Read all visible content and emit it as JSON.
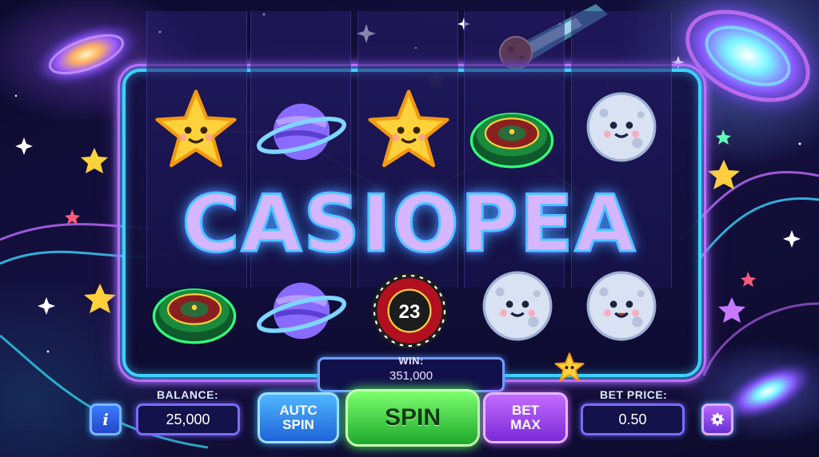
{
  "game": {
    "title": "CASIOPEA"
  },
  "reels": [
    [
      "star",
      "wheel-green"
    ],
    [
      "planet",
      "planet"
    ],
    [
      "star",
      "roulette-wheel"
    ],
    [
      "wheel-green",
      "moon"
    ],
    [
      "moon",
      "moon"
    ]
  ],
  "roulette_number": "23",
  "win": {
    "label": "WIN:",
    "value": "351,000"
  },
  "balance": {
    "label": "BALANCE:",
    "value": "25,000"
  },
  "bet_price": {
    "label": "BET PRICE:",
    "value": "0.50"
  },
  "buttons": {
    "info": "i",
    "auto_spin": "AUTC\nSPIN",
    "spin": "SPIN",
    "bet_max": "BET\nMAX"
  },
  "icons": [
    "info-icon",
    "settings-gear-icon",
    "star-icon",
    "planet-icon",
    "moon-icon",
    "roulette-icon",
    "comet-icon",
    "galaxy-icon"
  ],
  "colors": {
    "frame_neon_blue": "#3fd0ff",
    "frame_neon_purple": "#c36bff",
    "spin_green": "#2fd43b",
    "auto_blue": "#1f63d8",
    "bet_purple": "#7a2bd6"
  }
}
